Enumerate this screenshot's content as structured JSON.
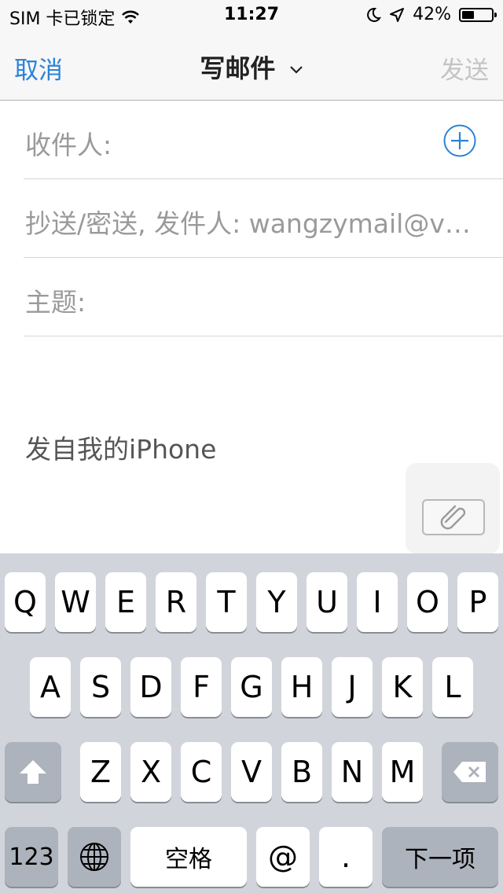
{
  "status_bar": {
    "carrier": "SIM 卡已锁定",
    "time": "11:27",
    "battery_percent": "42%",
    "battery_level": 0.42
  },
  "nav": {
    "cancel": "取消",
    "title": "写邮件",
    "send": "发送"
  },
  "fields": {
    "to_label": "收件人:",
    "cc_label": "抄送/密送, 发件人: wangzymail@v…",
    "subject_label": "主题:"
  },
  "body": {
    "signature": "发自我的iPhone"
  },
  "keyboard": {
    "row1": [
      "Q",
      "W",
      "E",
      "R",
      "T",
      "Y",
      "U",
      "I",
      "O",
      "P"
    ],
    "row2": [
      "A",
      "S",
      "D",
      "F",
      "G",
      "H",
      "J",
      "K",
      "L"
    ],
    "row3": [
      "Z",
      "X",
      "C",
      "V",
      "B",
      "N",
      "M"
    ],
    "numbers": "123",
    "space": "空格",
    "at": "@",
    "dot": ".",
    "next": "下一项"
  },
  "colors": {
    "accent": "#2b83d8",
    "disabled": "#c4c4c4",
    "keyboard_bg": "#d1d5db"
  },
  "icons": [
    "wifi-icon",
    "moon-icon",
    "location-icon",
    "battery-icon",
    "chevron-down-icon",
    "add-contact-icon",
    "paperclip-icon",
    "shift-icon",
    "globe-icon",
    "delete-icon"
  ]
}
